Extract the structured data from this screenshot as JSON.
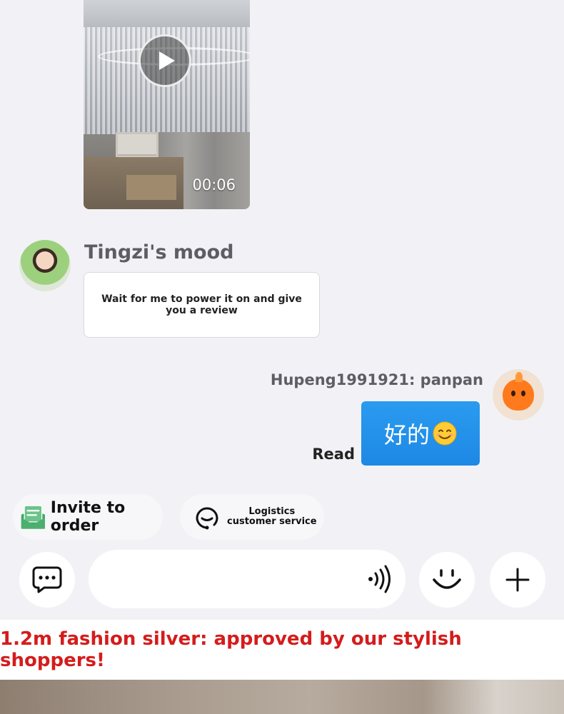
{
  "video_message": {
    "duration": "00:06"
  },
  "incoming_message": {
    "sender": "Tingzi's mood",
    "text": "Wait for me to power it on and give you a review"
  },
  "outgoing_message": {
    "sender": "Hupeng1991921: panpan",
    "text": "好的",
    "emoji": "smiling-face-emoji",
    "status": "Read"
  },
  "quick_actions": {
    "invite_label": "Invite to order",
    "logistics_line1": "Logistics",
    "logistics_line2": "customer service"
  },
  "input_bar": {
    "placeholder": ""
  },
  "promo": {
    "text": "1.2m fashion silver: approved by our stylish shoppers!"
  },
  "colors": {
    "accent_blue": "#1e88e5",
    "promo_red": "#d41c1c",
    "invite_green": "#4caf70",
    "background": "#f2f2f6"
  }
}
